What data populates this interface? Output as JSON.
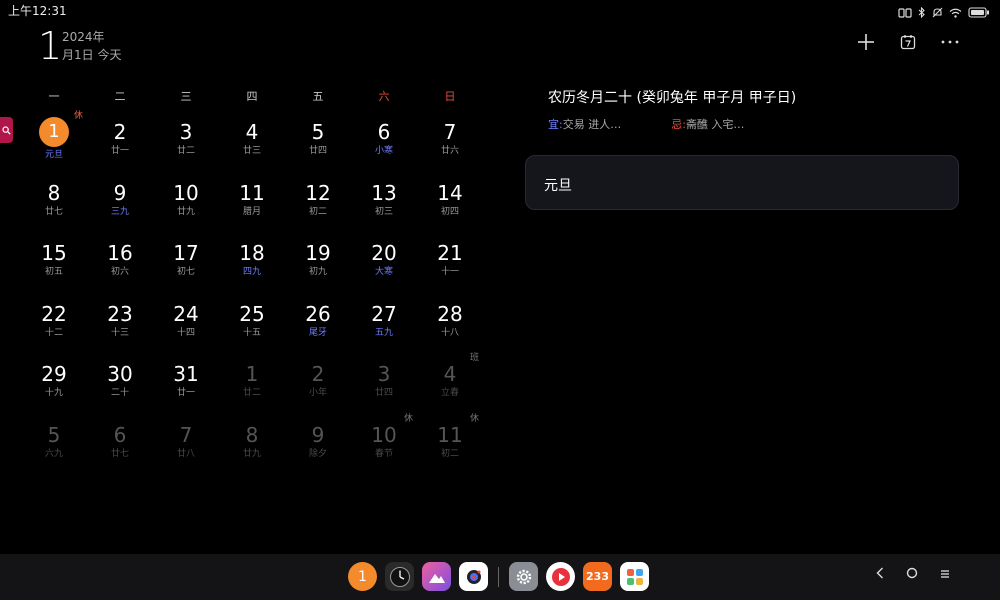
{
  "status_bar": {
    "time": "上午12:31"
  },
  "header": {
    "big_day": "1",
    "year": "2024年",
    "date_today": "月1日  今天"
  },
  "weekdays": [
    "一",
    "二",
    "三",
    "四",
    "五",
    "六",
    "日"
  ],
  "calendar": {
    "weeks": [
      [
        {
          "day": "1",
          "lunar": "元旦",
          "term": true,
          "today": true,
          "mark": "休",
          "mark_type": "rest"
        },
        {
          "day": "2",
          "lunar": "廿一"
        },
        {
          "day": "3",
          "lunar": "廿二"
        },
        {
          "day": "4",
          "lunar": "廿三"
        },
        {
          "day": "5",
          "lunar": "廿四"
        },
        {
          "day": "6",
          "lunar": "小寒",
          "term": true
        },
        {
          "day": "7",
          "lunar": "廿六"
        }
      ],
      [
        {
          "day": "8",
          "lunar": "廿七"
        },
        {
          "day": "9",
          "lunar": "三九",
          "term": true
        },
        {
          "day": "10",
          "lunar": "廿九"
        },
        {
          "day": "11",
          "lunar": "腊月"
        },
        {
          "day": "12",
          "lunar": "初二"
        },
        {
          "day": "13",
          "lunar": "初三"
        },
        {
          "day": "14",
          "lunar": "初四"
        }
      ],
      [
        {
          "day": "15",
          "lunar": "初五"
        },
        {
          "day": "16",
          "lunar": "初六"
        },
        {
          "day": "17",
          "lunar": "初七"
        },
        {
          "day": "18",
          "lunar": "四九",
          "term": true
        },
        {
          "day": "19",
          "lunar": "初九"
        },
        {
          "day": "20",
          "lunar": "大寒",
          "term": true
        },
        {
          "day": "21",
          "lunar": "十一"
        }
      ],
      [
        {
          "day": "22",
          "lunar": "十二"
        },
        {
          "day": "23",
          "lunar": "十三"
        },
        {
          "day": "24",
          "lunar": "十四"
        },
        {
          "day": "25",
          "lunar": "十五"
        },
        {
          "day": "26",
          "lunar": "尾牙",
          "term": true
        },
        {
          "day": "27",
          "lunar": "五九",
          "term": true
        },
        {
          "day": "28",
          "lunar": "十八"
        }
      ],
      [
        {
          "day": "29",
          "lunar": "十九"
        },
        {
          "day": "30",
          "lunar": "二十"
        },
        {
          "day": "31",
          "lunar": "廿一"
        },
        {
          "day": "1",
          "lunar": "廿二",
          "other": true
        },
        {
          "day": "2",
          "lunar": "小年",
          "other": true
        },
        {
          "day": "3",
          "lunar": "廿四",
          "other": true
        },
        {
          "day": "4",
          "lunar": "立春",
          "other": true,
          "mark": "班",
          "mark_type": "work"
        }
      ],
      [
        {
          "day": "5",
          "lunar": "六九",
          "other": true
        },
        {
          "day": "6",
          "lunar": "廿七",
          "other": true
        },
        {
          "day": "7",
          "lunar": "廿八",
          "other": true
        },
        {
          "day": "8",
          "lunar": "廿九",
          "other": true
        },
        {
          "day": "9",
          "lunar": "除夕",
          "other": true
        },
        {
          "day": "10",
          "lunar": "春节",
          "other": true,
          "mark": "休",
          "mark_type": "rest"
        },
        {
          "day": "11",
          "lunar": "初二",
          "other": true,
          "mark": "休",
          "mark_type": "rest"
        }
      ]
    ]
  },
  "detail": {
    "lunar_title": "农历冬月二十  (癸卯兔年 甲子月 甲子日)",
    "yi_char": "宜:",
    "yi_text": "交易 进人…",
    "ji_char": "忌:",
    "ji_text": "斋醮 入宅…",
    "event": "元旦"
  },
  "dock": {
    "calendar_app_label": "1",
    "game_app_label": "233"
  },
  "colors": {
    "accent_today": "#f38a2c",
    "solar_term": "#6e7dff",
    "weekend": "#e84e3e",
    "background": "#000000"
  }
}
